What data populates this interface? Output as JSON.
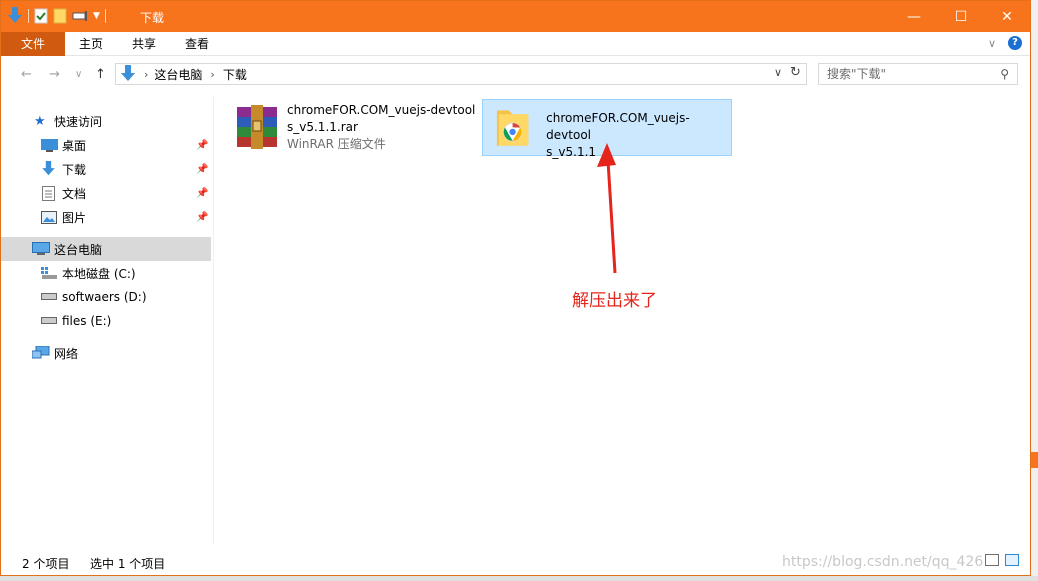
{
  "window": {
    "title": "下载",
    "controls": {
      "minimize": "—",
      "maximize": "☐",
      "close": "✕"
    }
  },
  "ribbon": {
    "tabs": [
      {
        "label": "文件"
      },
      {
        "label": "主页"
      },
      {
        "label": "共享"
      },
      {
        "label": "查看"
      }
    ]
  },
  "address": {
    "crumbs": [
      "这台电脑",
      "下载"
    ],
    "search_placeholder": "搜索\"下载\""
  },
  "sidebar": {
    "quick_access": "快速访问",
    "items": [
      {
        "label": "桌面"
      },
      {
        "label": "下载"
      },
      {
        "label": "文档"
      },
      {
        "label": "图片"
      }
    ],
    "this_pc": "这台电脑",
    "drives": [
      {
        "label": "本地磁盘 (C:)"
      },
      {
        "label": "softwaers (D:)"
      },
      {
        "label": "files (E:)"
      }
    ],
    "network": "网络"
  },
  "files": [
    {
      "name_line1": "chromeFOR.COM_vuejs-devtool",
      "name_line2": "s_v5.1.1.rar",
      "type": "WinRAR 压缩文件"
    },
    {
      "name_line1": "chromeFOR.COM_vuejs-devtool",
      "name_line2": "s_v5.1.1"
    }
  ],
  "annotation": "解压出来了",
  "status": {
    "count": "2 个项目",
    "selected": "选中 1 个项目"
  },
  "watermark": "https://blog.csdn.net/qq_426"
}
